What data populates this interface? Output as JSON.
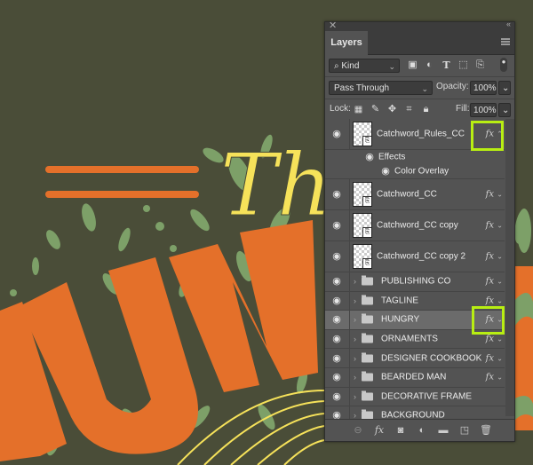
{
  "artwork": {
    "script_text": "Th",
    "headline_text": "IUN",
    "colors": {
      "background": "#4a4d38",
      "orange": "#e4702a",
      "green": "#7da068",
      "yellow": "#f6e25a"
    }
  },
  "panel": {
    "close_icon": "✕",
    "collapse_icon": "‹‹",
    "tab_label": "Layers",
    "filter": {
      "kind_label": "Kind",
      "icons": [
        "image-filter-icon",
        "adjustment-filter-icon",
        "type-filter-icon",
        "shape-filter-icon",
        "smart-object-filter-icon"
      ]
    },
    "blend_mode": "Pass Through",
    "opacity_label": "Opacity:",
    "opacity_value": "100%",
    "lock_label": "Lock:",
    "fill_label": "Fill:",
    "fill_value": "100%",
    "layers": [
      {
        "name": "Catchword_Rules_CC",
        "type": "smart",
        "fx": true,
        "expanded": true,
        "highlighted_fx": true,
        "effects_label": "Effects",
        "effects": [
          "Color Overlay"
        ]
      },
      {
        "name": "Catchword_CC",
        "type": "smart",
        "fx": true
      },
      {
        "name": "Catchword_CC copy",
        "type": "smart",
        "fx": true
      },
      {
        "name": "Catchword_CC copy 2",
        "type": "smart",
        "fx": true
      },
      {
        "name": "PUBLISHING CO",
        "type": "group",
        "fx": true
      },
      {
        "name": "TAGLINE",
        "type": "group",
        "fx": true
      },
      {
        "name": "HUNGRY",
        "type": "group",
        "fx": true,
        "selected": true,
        "highlighted_fx": true
      },
      {
        "name": "ORNAMENTS",
        "type": "group",
        "fx": true
      },
      {
        "name": "DESIGNER COOKBOOK",
        "type": "group",
        "fx": true
      },
      {
        "name": "BEARDED MAN",
        "type": "group",
        "fx": true
      },
      {
        "name": "DECORATIVE FRAME",
        "type": "group",
        "fx": false
      },
      {
        "name": "BACKGROUND",
        "type": "group",
        "fx": false
      }
    ],
    "fx_label": "fx",
    "highlight_color": "#b8ee12",
    "bottom_icons": [
      "link-layers-icon",
      "fx-icon",
      "mask-icon",
      "adjustment-icon",
      "new-group-icon",
      "new-layer-icon",
      "delete-icon"
    ]
  }
}
